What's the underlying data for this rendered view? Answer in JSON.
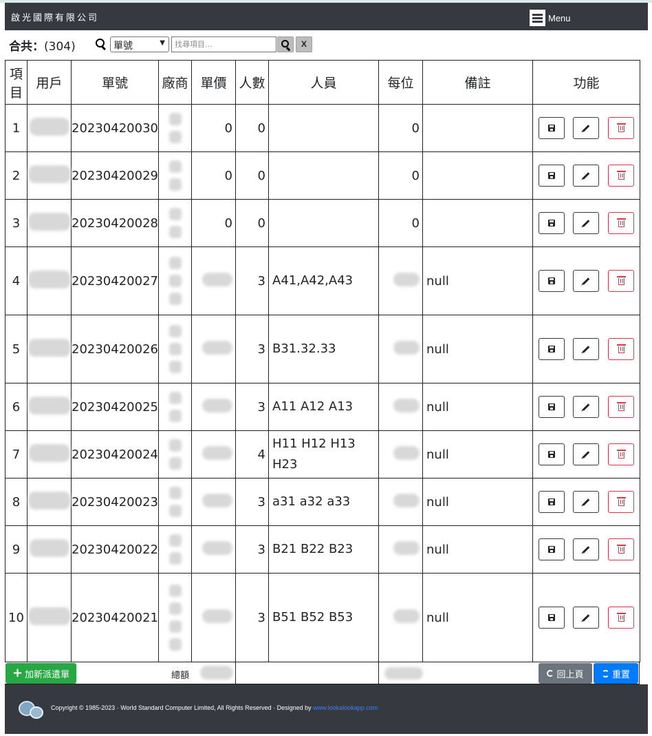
{
  "header": {
    "brand": "啟光國際有限公司",
    "menu_label": "Menu"
  },
  "toolbar": {
    "total_label": "合共：",
    "total_count": "(304)",
    "search_field": "單號",
    "search_placeholder": "找尋項目...",
    "clear_label": "X"
  },
  "table": {
    "columns": [
      "項目",
      "用戶",
      "單號",
      "廠商",
      "單價",
      "人數",
      "人員",
      "每位",
      "備註",
      "功能"
    ],
    "rows": [
      {
        "idx": "1",
        "order": "20230420030",
        "price": "0",
        "count": "0",
        "staff": "",
        "each": "0",
        "note": ""
      },
      {
        "idx": "2",
        "order": "20230420029",
        "price": "0",
        "count": "0",
        "staff": "",
        "each": "0",
        "note": ""
      },
      {
        "idx": "3",
        "order": "20230420028",
        "price": "0",
        "count": "0",
        "staff": "",
        "each": "0",
        "note": ""
      },
      {
        "idx": "4",
        "order": "20230420027",
        "price": "",
        "count": "3",
        "staff": "A41,A42,A43",
        "each": "",
        "note": "null"
      },
      {
        "idx": "5",
        "order": "20230420026",
        "price": "",
        "count": "3",
        "staff": "B31.32.33",
        "each": "",
        "note": "null"
      },
      {
        "idx": "6",
        "order": "20230420025",
        "price": "",
        "count": "3",
        "staff": "A11 A12 A13",
        "each": "",
        "note": "null"
      },
      {
        "idx": "7",
        "order": "20230420024",
        "price": "",
        "count": "4",
        "staff": "H11 H12 H13 H23",
        "each": "",
        "note": "null"
      },
      {
        "idx": "8",
        "order": "20230420023",
        "price": "",
        "count": "3",
        "staff": "a31 a32 a33",
        "each": "",
        "note": "null"
      },
      {
        "idx": "9",
        "order": "20230420022",
        "price": "",
        "count": "3",
        "staff": "B21 B22 B23",
        "each": "",
        "note": "null"
      },
      {
        "idx": "10",
        "order": "20230420021",
        "price": "",
        "count": "3",
        "staff": "B51 B52 B53",
        "each": "",
        "note": "null"
      }
    ]
  },
  "actions": {
    "save_icon": "save-icon",
    "edit_icon": "pencil-icon",
    "delete_icon": "trash-icon"
  },
  "bottom": {
    "add_label": "加新派遣單",
    "sum_label": "總額",
    "back_label": "回上頁",
    "reset_label": "重置"
  },
  "footer": {
    "copyright": "Copyright © 1985-2023 · World Standard Computer Limited, All Rights Reserved · Designed by",
    "link_text": "www.lookalookapp.com"
  },
  "colors": {
    "navbar": "#343a40",
    "add": "#28a745",
    "back": "#6c757d",
    "reset": "#007bff",
    "delete": "#dc3545",
    "link": "#3b82f6"
  }
}
